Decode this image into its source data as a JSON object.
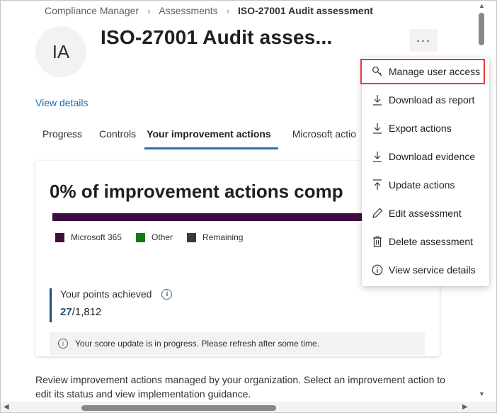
{
  "breadcrumb": {
    "items": [
      "Compliance Manager",
      "Assessments"
    ],
    "separator": "›",
    "current": "ISO-27001 Audit assessment"
  },
  "header": {
    "avatar_initials": "IA",
    "title": "ISO-27001 Audit asses...",
    "more_label": "···",
    "view_details": "View details"
  },
  "tabs": [
    {
      "label": "Progress",
      "active": false
    },
    {
      "label": "Controls",
      "active": false
    },
    {
      "label": "Your improvement actions",
      "active": true
    },
    {
      "label": "Microsoft actio",
      "active": false
    }
  ],
  "card": {
    "heading": "0% of improvement actions comp",
    "progress_color": "#3f0e41",
    "legend": [
      {
        "label": "Microsoft 365",
        "color": "#3f0e41"
      },
      {
        "label": "Other",
        "color": "#107c10"
      },
      {
        "label": "Remaining",
        "color": "#3b3a39"
      }
    ],
    "points_label": "Your points achieved",
    "points_achieved": "27",
    "points_total": "/1,812",
    "notice": "Your score update is in progress. Please refresh after some time."
  },
  "description": "Review improvement actions managed by your organization. Select an improvement action to edit its status and view implementation guidance.",
  "menu": {
    "items": [
      {
        "label": "Manage user access",
        "icon": "key-icon",
        "highlighted": true
      },
      {
        "label": "Download as report",
        "icon": "download-icon"
      },
      {
        "label": "Export actions",
        "icon": "export-icon"
      },
      {
        "label": "Download evidence",
        "icon": "download-evidence-icon"
      },
      {
        "label": "Update actions",
        "icon": "upload-icon"
      },
      {
        "label": "Edit assessment",
        "icon": "pencil-icon"
      },
      {
        "label": "Delete assessment",
        "icon": "trash-icon"
      },
      {
        "label": "View service details",
        "icon": "info-icon"
      }
    ]
  },
  "colors": {
    "accent": "#0f6cbd",
    "tab_underline": "#2d6da8",
    "highlight_outline": "#e03c3c"
  }
}
